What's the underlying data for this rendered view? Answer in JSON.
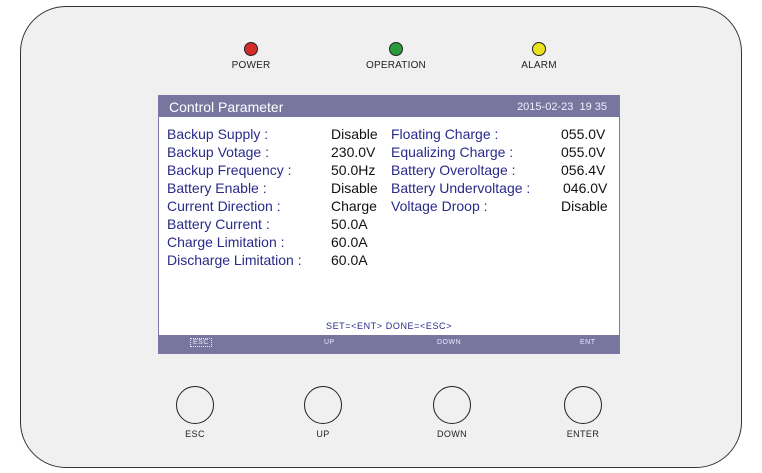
{
  "indicators": [
    {
      "label": "POWER",
      "color": "#d42b2b"
    },
    {
      "label": "OPERATION",
      "color": "#2a9a3a"
    },
    {
      "label": "ALARM",
      "color": "#e8e21f"
    }
  ],
  "screen": {
    "title": "Control Parameter",
    "date": "2015-02-23",
    "time": "19 35",
    "left_params": [
      {
        "label": "Backup Supply :",
        "value": "Disable"
      },
      {
        "label": "Backup Votage :",
        "value": "230.0V"
      },
      {
        "label": "Backup Frequency :",
        "value": "50.0Hz"
      },
      {
        "label": "Battery Enable :",
        "value": "Disable"
      },
      {
        "label": "Current Direction :",
        "value": "Charge"
      },
      {
        "label": "Battery Current :",
        "value": "50.0A"
      },
      {
        "label": "Charge Limitation :",
        "value": "60.0A"
      },
      {
        "label": "Discharge Limitation :",
        "value": "60.0A"
      }
    ],
    "right_params": [
      {
        "label": "Floating Charge :",
        "value": "055.0V"
      },
      {
        "label": "Equalizing Charge :",
        "value": "055.0V"
      },
      {
        "label": "Battery Overoltage :",
        "value": "056.4V"
      },
      {
        "label": "Battery Undervoltage :",
        "value": "046.0V"
      },
      {
        "label": "Voltage Droop :",
        "value": "Disable"
      }
    ],
    "hint": "SET=<ENT> DONE=<ESC>",
    "softkeys": [
      "ESC",
      "UP",
      "DOWN",
      "ENT"
    ]
  },
  "buttons": [
    "ESC",
    "UP",
    "DOWN",
    "ENTER"
  ]
}
